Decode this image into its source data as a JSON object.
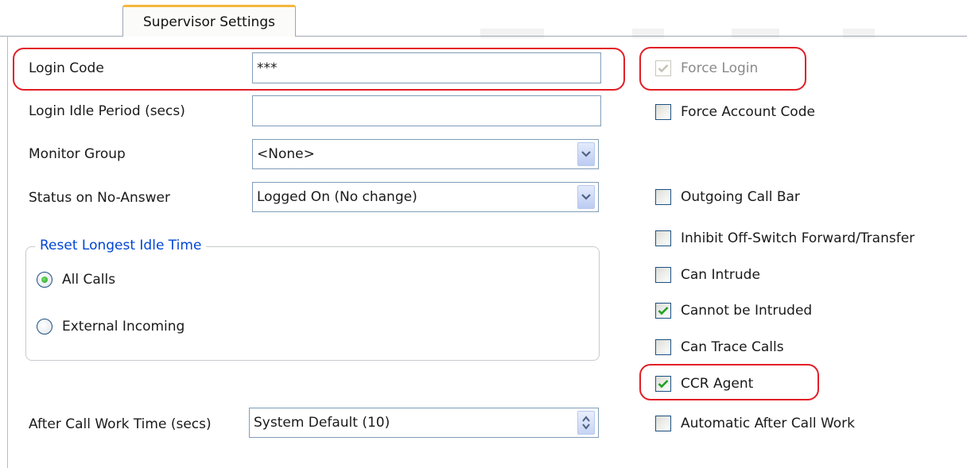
{
  "tab": {
    "label": "Supervisor Settings"
  },
  "fields": {
    "login_code": {
      "label": "Login Code",
      "value": "***"
    },
    "login_idle_period": {
      "label": "Login Idle Period (secs)",
      "value": ""
    },
    "monitor_group": {
      "label": "Monitor Group",
      "value": "<None>"
    },
    "status_no_answer": {
      "label": "Status on No-Answer",
      "value": "Logged On (No change)"
    },
    "after_call_work_time": {
      "label": "After Call Work Time (secs)",
      "value": "System Default (10)"
    }
  },
  "reset_idle": {
    "legend": "Reset Longest Idle Time",
    "options": [
      {
        "label": "All Calls",
        "selected": true
      },
      {
        "label": "External Incoming",
        "selected": false
      }
    ]
  },
  "checkboxes": {
    "force_login": {
      "label": "Force Login",
      "checked": true,
      "disabled": true
    },
    "force_account_code": {
      "label": "Force Account Code",
      "checked": false
    },
    "outgoing_call_bar": {
      "label": "Outgoing Call Bar",
      "checked": false
    },
    "inhibit_off_switch": {
      "label": "Inhibit Off-Switch Forward/Transfer",
      "checked": false
    },
    "can_intrude": {
      "label": "Can Intrude",
      "checked": false
    },
    "cannot_be_intruded": {
      "label": "Cannot be Intruded",
      "checked": true
    },
    "can_trace_calls": {
      "label": "Can Trace Calls",
      "checked": false
    },
    "ccr_agent": {
      "label": "CCR Agent",
      "checked": true
    },
    "automatic_after_call_work": {
      "label": "Automatic After Call Work",
      "checked": false
    }
  },
  "colors": {
    "highlight": "#e21e26",
    "tab_accent": "#f5b73c",
    "group_legend": "#0046d5",
    "check_green": "#21a121"
  }
}
